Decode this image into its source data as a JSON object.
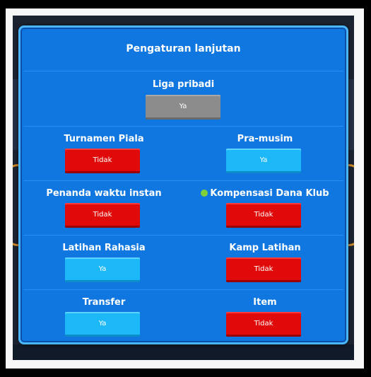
{
  "panel": {
    "title": "Pengaturan lanjutan"
  },
  "settings": {
    "liga_pribadi": {
      "label": "Liga pribadi",
      "value": "Ya",
      "state": "disabled"
    },
    "turnamen_piala": {
      "label": "Turnamen Piala",
      "value": "Tidak",
      "state": "off"
    },
    "pra_musim": {
      "label": "Pra-musim",
      "value": "Ya",
      "state": "on"
    },
    "penanda_waktu": {
      "label": "Penanda waktu instan",
      "value": "Tidak",
      "state": "off"
    },
    "kompensasi": {
      "label": "Kompensasi Dana Klub",
      "value": "Tidak",
      "state": "off",
      "icon": "coin-icon"
    },
    "latihan_rahasia": {
      "label": "Latihan Rahasia",
      "value": "Ya",
      "state": "on"
    },
    "kamp_latihan": {
      "label": "Kamp Latihan",
      "value": "Tidak",
      "state": "off"
    },
    "transfer": {
      "label": "Transfer",
      "value": "Ya",
      "state": "on"
    },
    "item": {
      "label": "Item",
      "value": "Tidak",
      "state": "off"
    }
  },
  "colors": {
    "panel": "#1177e0",
    "on": "#1cb8f7",
    "off": "#e00a0a",
    "disabled": "#8c8c8c"
  }
}
